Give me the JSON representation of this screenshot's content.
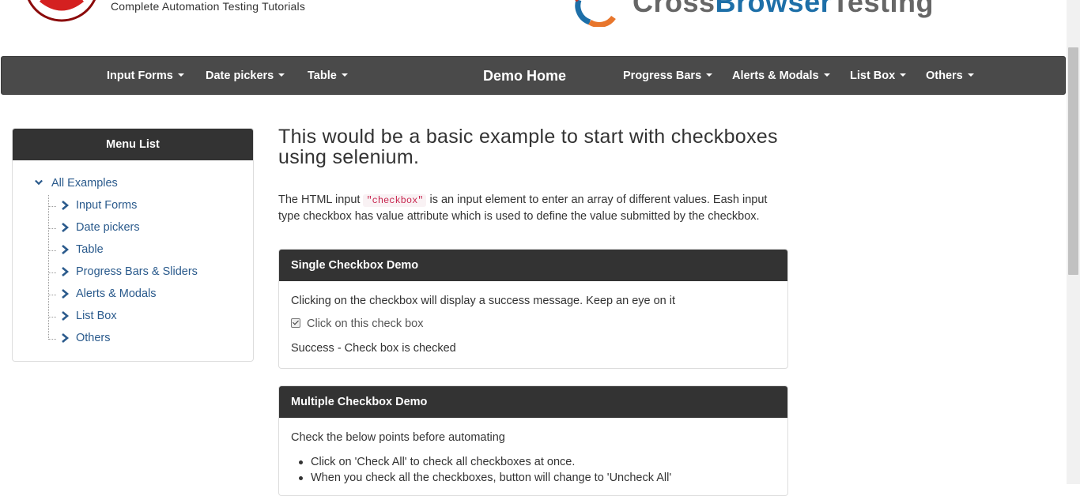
{
  "header": {
    "tagline": "Complete Automation Testing Tutorials",
    "right_logo_text_a": "Cross",
    "right_logo_text_b": "Browser",
    "right_logo_text_c": "Testing"
  },
  "nav": {
    "input_forms": "Input Forms",
    "date_pickers": "Date pickers",
    "table": "Table",
    "demo_home": "Demo Home",
    "progress_bars": "Progress Bars",
    "alerts_modals": "Alerts & Modals",
    "list_box": "List Box",
    "others": "Others"
  },
  "sidebar": {
    "title": "Menu List",
    "root": "All Examples",
    "items": [
      {
        "label": "Input Forms"
      },
      {
        "label": "Date pickers"
      },
      {
        "label": "Table"
      },
      {
        "label": "Progress Bars & Sliders"
      },
      {
        "label": "Alerts & Modals"
      },
      {
        "label": "List Box"
      },
      {
        "label": "Others"
      }
    ]
  },
  "main": {
    "title": "This would be a basic example to start with checkboxes using selenium.",
    "intro_before": "The HTML input ",
    "intro_code": "\"checkbox\"",
    "intro_after": " is an input element to enter an array of different values. Eash input type checkbox has value attribute which is used to define the value submitted by the checkbox."
  },
  "single_panel": {
    "title": "Single Checkbox Demo",
    "description": "Clicking on the checkbox will display a success message. Keep an eye on it",
    "checkbox_label": "Click on this check box",
    "checkbox_checked": true,
    "success_message": "Success - Check box is checked"
  },
  "multi_panel": {
    "title": "Multiple Checkbox Demo",
    "description": "Check the below points before automating",
    "points": [
      "Click on 'Check All' to check all checkboxes at once.",
      "When you check all the checkboxes, button will change to 'Uncheck All'"
    ]
  }
}
